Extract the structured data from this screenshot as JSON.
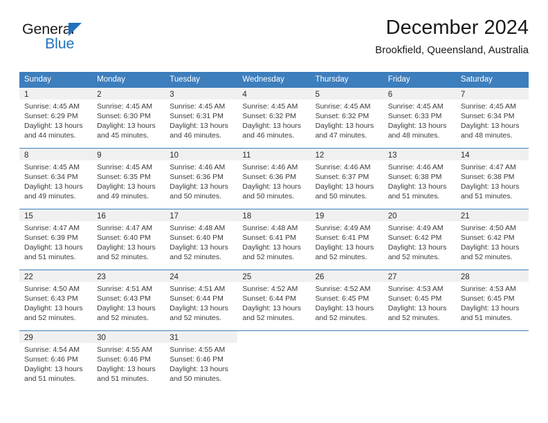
{
  "brand": {
    "name_top": "General",
    "name_bottom": "Blue",
    "triangle_icon": "triangle-icon",
    "color_blue": "#1f72bd",
    "color_dark": "#1b1b1b"
  },
  "header": {
    "title": "December 2024",
    "subtitle": "Brookfield, Queensland, Australia"
  },
  "theme": {
    "header_blue": "#3d7ebd",
    "day_band_gray": "#f0f0f0",
    "text": "#3a3a3a"
  },
  "weekdays": [
    "Sunday",
    "Monday",
    "Tuesday",
    "Wednesday",
    "Thursday",
    "Friday",
    "Saturday"
  ],
  "weeks": [
    [
      {
        "day": "1",
        "sunrise": "Sunrise: 4:45 AM",
        "sunset": "Sunset: 6:29 PM",
        "daylight1": "Daylight: 13 hours",
        "daylight2": "and 44 minutes."
      },
      {
        "day": "2",
        "sunrise": "Sunrise: 4:45 AM",
        "sunset": "Sunset: 6:30 PM",
        "daylight1": "Daylight: 13 hours",
        "daylight2": "and 45 minutes."
      },
      {
        "day": "3",
        "sunrise": "Sunrise: 4:45 AM",
        "sunset": "Sunset: 6:31 PM",
        "daylight1": "Daylight: 13 hours",
        "daylight2": "and 46 minutes."
      },
      {
        "day": "4",
        "sunrise": "Sunrise: 4:45 AM",
        "sunset": "Sunset: 6:32 PM",
        "daylight1": "Daylight: 13 hours",
        "daylight2": "and 46 minutes."
      },
      {
        "day": "5",
        "sunrise": "Sunrise: 4:45 AM",
        "sunset": "Sunset: 6:32 PM",
        "daylight1": "Daylight: 13 hours",
        "daylight2": "and 47 minutes."
      },
      {
        "day": "6",
        "sunrise": "Sunrise: 4:45 AM",
        "sunset": "Sunset: 6:33 PM",
        "daylight1": "Daylight: 13 hours",
        "daylight2": "and 48 minutes."
      },
      {
        "day": "7",
        "sunrise": "Sunrise: 4:45 AM",
        "sunset": "Sunset: 6:34 PM",
        "daylight1": "Daylight: 13 hours",
        "daylight2": "and 48 minutes."
      }
    ],
    [
      {
        "day": "8",
        "sunrise": "Sunrise: 4:45 AM",
        "sunset": "Sunset: 6:34 PM",
        "daylight1": "Daylight: 13 hours",
        "daylight2": "and 49 minutes."
      },
      {
        "day": "9",
        "sunrise": "Sunrise: 4:45 AM",
        "sunset": "Sunset: 6:35 PM",
        "daylight1": "Daylight: 13 hours",
        "daylight2": "and 49 minutes."
      },
      {
        "day": "10",
        "sunrise": "Sunrise: 4:46 AM",
        "sunset": "Sunset: 6:36 PM",
        "daylight1": "Daylight: 13 hours",
        "daylight2": "and 50 minutes."
      },
      {
        "day": "11",
        "sunrise": "Sunrise: 4:46 AM",
        "sunset": "Sunset: 6:36 PM",
        "daylight1": "Daylight: 13 hours",
        "daylight2": "and 50 minutes."
      },
      {
        "day": "12",
        "sunrise": "Sunrise: 4:46 AM",
        "sunset": "Sunset: 6:37 PM",
        "daylight1": "Daylight: 13 hours",
        "daylight2": "and 50 minutes."
      },
      {
        "day": "13",
        "sunrise": "Sunrise: 4:46 AM",
        "sunset": "Sunset: 6:38 PM",
        "daylight1": "Daylight: 13 hours",
        "daylight2": "and 51 minutes."
      },
      {
        "day": "14",
        "sunrise": "Sunrise: 4:47 AM",
        "sunset": "Sunset: 6:38 PM",
        "daylight1": "Daylight: 13 hours",
        "daylight2": "and 51 minutes."
      }
    ],
    [
      {
        "day": "15",
        "sunrise": "Sunrise: 4:47 AM",
        "sunset": "Sunset: 6:39 PM",
        "daylight1": "Daylight: 13 hours",
        "daylight2": "and 51 minutes."
      },
      {
        "day": "16",
        "sunrise": "Sunrise: 4:47 AM",
        "sunset": "Sunset: 6:40 PM",
        "daylight1": "Daylight: 13 hours",
        "daylight2": "and 52 minutes."
      },
      {
        "day": "17",
        "sunrise": "Sunrise: 4:48 AM",
        "sunset": "Sunset: 6:40 PM",
        "daylight1": "Daylight: 13 hours",
        "daylight2": "and 52 minutes."
      },
      {
        "day": "18",
        "sunrise": "Sunrise: 4:48 AM",
        "sunset": "Sunset: 6:41 PM",
        "daylight1": "Daylight: 13 hours",
        "daylight2": "and 52 minutes."
      },
      {
        "day": "19",
        "sunrise": "Sunrise: 4:49 AM",
        "sunset": "Sunset: 6:41 PM",
        "daylight1": "Daylight: 13 hours",
        "daylight2": "and 52 minutes."
      },
      {
        "day": "20",
        "sunrise": "Sunrise: 4:49 AM",
        "sunset": "Sunset: 6:42 PM",
        "daylight1": "Daylight: 13 hours",
        "daylight2": "and 52 minutes."
      },
      {
        "day": "21",
        "sunrise": "Sunrise: 4:50 AM",
        "sunset": "Sunset: 6:42 PM",
        "daylight1": "Daylight: 13 hours",
        "daylight2": "and 52 minutes."
      }
    ],
    [
      {
        "day": "22",
        "sunrise": "Sunrise: 4:50 AM",
        "sunset": "Sunset: 6:43 PM",
        "daylight1": "Daylight: 13 hours",
        "daylight2": "and 52 minutes."
      },
      {
        "day": "23",
        "sunrise": "Sunrise: 4:51 AM",
        "sunset": "Sunset: 6:43 PM",
        "daylight1": "Daylight: 13 hours",
        "daylight2": "and 52 minutes."
      },
      {
        "day": "24",
        "sunrise": "Sunrise: 4:51 AM",
        "sunset": "Sunset: 6:44 PM",
        "daylight1": "Daylight: 13 hours",
        "daylight2": "and 52 minutes."
      },
      {
        "day": "25",
        "sunrise": "Sunrise: 4:52 AM",
        "sunset": "Sunset: 6:44 PM",
        "daylight1": "Daylight: 13 hours",
        "daylight2": "and 52 minutes."
      },
      {
        "day": "26",
        "sunrise": "Sunrise: 4:52 AM",
        "sunset": "Sunset: 6:45 PM",
        "daylight1": "Daylight: 13 hours",
        "daylight2": "and 52 minutes."
      },
      {
        "day": "27",
        "sunrise": "Sunrise: 4:53 AM",
        "sunset": "Sunset: 6:45 PM",
        "daylight1": "Daylight: 13 hours",
        "daylight2": "and 52 minutes."
      },
      {
        "day": "28",
        "sunrise": "Sunrise: 4:53 AM",
        "sunset": "Sunset: 6:45 PM",
        "daylight1": "Daylight: 13 hours",
        "daylight2": "and 51 minutes."
      }
    ],
    [
      {
        "day": "29",
        "sunrise": "Sunrise: 4:54 AM",
        "sunset": "Sunset: 6:46 PM",
        "daylight1": "Daylight: 13 hours",
        "daylight2": "and 51 minutes."
      },
      {
        "day": "30",
        "sunrise": "Sunrise: 4:55 AM",
        "sunset": "Sunset: 6:46 PM",
        "daylight1": "Daylight: 13 hours",
        "daylight2": "and 51 minutes."
      },
      {
        "day": "31",
        "sunrise": "Sunrise: 4:55 AM",
        "sunset": "Sunset: 6:46 PM",
        "daylight1": "Daylight: 13 hours",
        "daylight2": "and 50 minutes."
      },
      {
        "day": "",
        "sunrise": "",
        "sunset": "",
        "daylight1": "",
        "daylight2": ""
      },
      {
        "day": "",
        "sunrise": "",
        "sunset": "",
        "daylight1": "",
        "daylight2": ""
      },
      {
        "day": "",
        "sunrise": "",
        "sunset": "",
        "daylight1": "",
        "daylight2": ""
      },
      {
        "day": "",
        "sunrise": "",
        "sunset": "",
        "daylight1": "",
        "daylight2": ""
      }
    ]
  ]
}
